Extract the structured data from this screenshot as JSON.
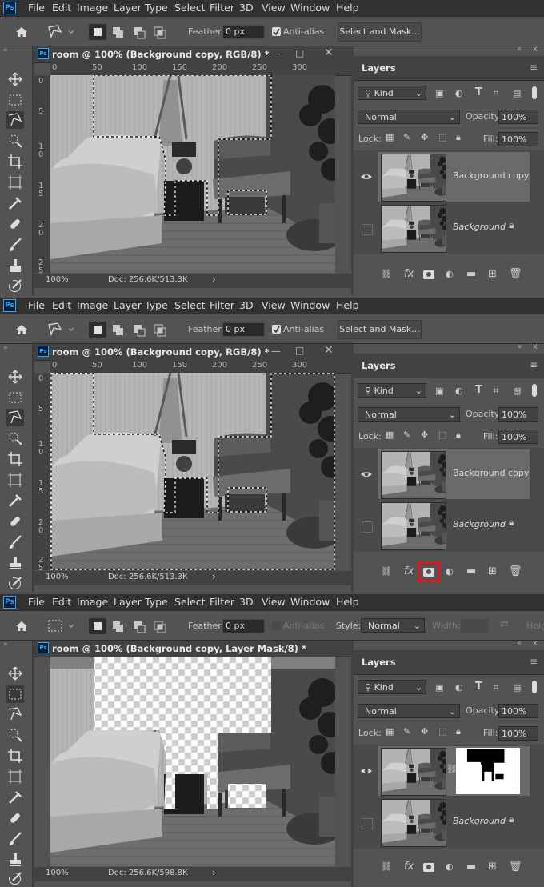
{
  "menu": [
    "File",
    "Edit",
    "Image",
    "Layer",
    "Type",
    "Select",
    "Filter",
    "3D",
    "View",
    "Window",
    "Help"
  ],
  "app_logo": "Ps",
  "options": {
    "feather_label": "Feather:",
    "feather_value": "0 px",
    "antialias_label": "Anti-alias",
    "select_mask_label": "Select and Mask...",
    "style_label": "Style:",
    "style_value": "Normal",
    "width_label": "Width:",
    "height_label": "Heig"
  },
  "document": {
    "title_1": "room @ 100% (Background copy, RGB/8) *",
    "title_3": "room @ 100% (Background copy, Layer Mask/8) *",
    "zoom": "100%",
    "doc_size_1": "Doc: 256.6K/513.3K",
    "doc_size_3": "Doc: 256.6K/598.8K",
    "ruler_h": [
      "0",
      "50",
      "100",
      "150",
      "200",
      "250",
      "300"
    ],
    "ruler_v": [
      "0",
      "5",
      "1\n0",
      "1\n5",
      "2\n0",
      "2\n5"
    ]
  },
  "layers": {
    "title": "Layers",
    "kind_label": "Kind",
    "blend_mode": "Normal",
    "opacity_label": "Opacity:",
    "opacity_value": "100%",
    "lock_label": "Lock:",
    "fill_label": "Fill:",
    "fill_value": "100%",
    "items": [
      {
        "name": "Background copy"
      },
      {
        "name": "Background"
      }
    ]
  },
  "colors": {
    "highlight": "#e0141b",
    "ps_blue": "#31a8ff"
  },
  "icons": [
    "home-icon",
    "polygonal-lasso-icon",
    "rect-marquee-icon",
    "move-icon",
    "lasso-icon",
    "quick-select-icon",
    "crop-icon",
    "frame-icon",
    "eyedropper-icon",
    "healing-icon",
    "brush-icon",
    "stamp-icon",
    "history-brush-icon",
    "eye-icon",
    "lock-icon",
    "link-icon",
    "fx-icon",
    "mask-icon",
    "adjustment-icon",
    "folder-icon",
    "new-layer-icon",
    "trash-icon"
  ]
}
